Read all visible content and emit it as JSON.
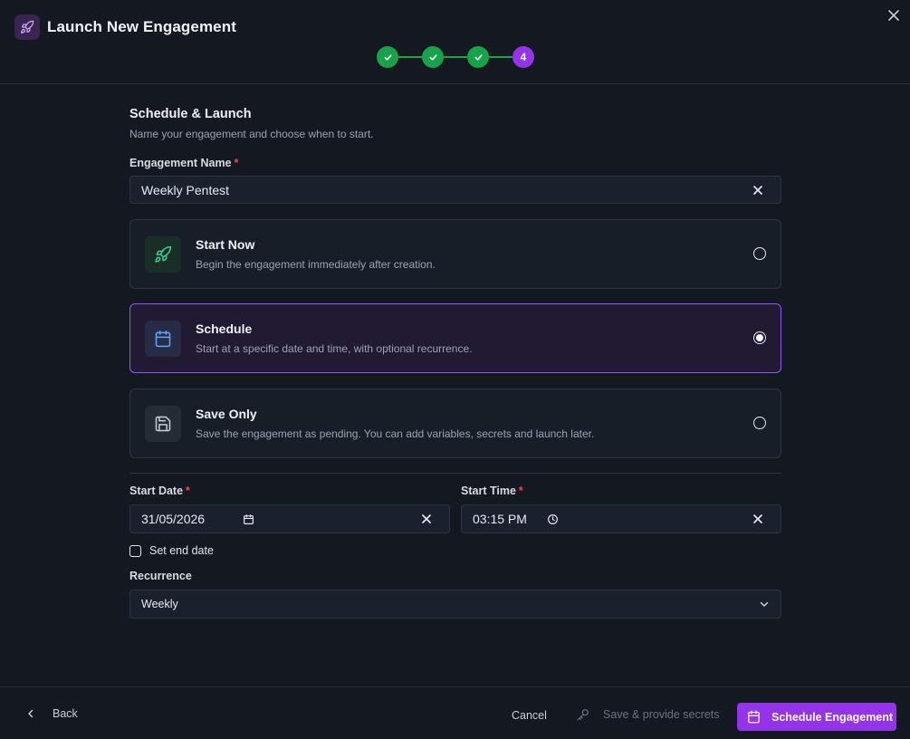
{
  "dialog": {
    "title": "Launch New Engagement",
    "close_icon": "close-icon",
    "app_icon": "rocket-icon"
  },
  "stepper": {
    "steps": [
      {
        "state": "done",
        "icon": "check-icon"
      },
      {
        "state": "done",
        "icon": "check-icon"
      },
      {
        "state": "done",
        "icon": "check-icon"
      },
      {
        "state": "active",
        "label": "4"
      }
    ],
    "current_step": 4
  },
  "section": {
    "title": "Schedule & Launch",
    "subtitle": "Name your engagement and choose when to start."
  },
  "engagement_name": {
    "label": "Engagement Name",
    "required_mark": "*",
    "value": "Weekly Pentest"
  },
  "options": [
    {
      "title": "Start Now",
      "description": "Begin the engagement immediately after creation.",
      "icon": "rocket-icon",
      "selected": false
    },
    {
      "title": "Schedule",
      "description": "Start at a specific date and time, with optional recurrence.",
      "icon": "calendar-icon",
      "selected": true
    },
    {
      "title": "Save Only",
      "description": "Save the engagement as pending. You can add variables, secrets and launch later.",
      "icon": "save-icon",
      "selected": false
    }
  ],
  "start_date": {
    "label": "Start Date",
    "required_mark": "*",
    "value": "31/05/2026"
  },
  "start_time": {
    "label": "Start Time",
    "required_mark": "*",
    "value": "03:15 PM"
  },
  "end_date": {
    "label": "Set end date",
    "checked": false
  },
  "recurrence": {
    "label": "Recurrence",
    "value": "Weekly"
  },
  "footer": {
    "back_label": "Back",
    "cancel_label": "Cancel",
    "secrets_label": "Save & provide secrets",
    "primary_label": "Schedule Engagement"
  },
  "colors": {
    "accent": "#9333ea",
    "success": "#16a34a",
    "required": "#ef4444",
    "background": "#131821"
  }
}
